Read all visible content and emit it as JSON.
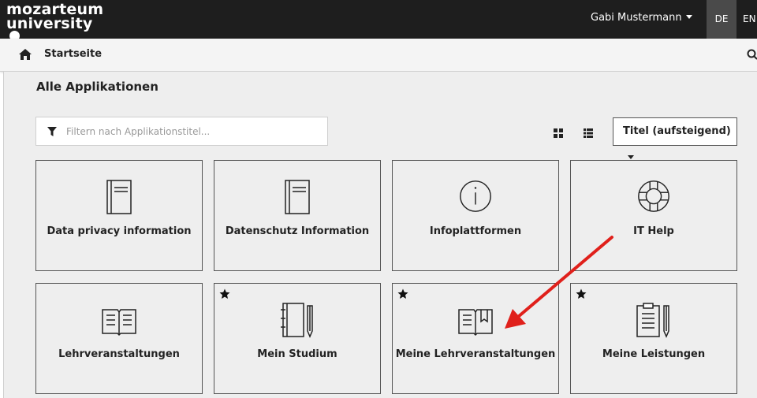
{
  "header": {
    "logo_line1": "mozarteum",
    "logo_line2": "university",
    "user_name": "Gabi Mustermann",
    "lang_de": "DE",
    "lang_en": "EN"
  },
  "nav": {
    "breadcrumb": "Startseite"
  },
  "main": {
    "title": "Alle Applikationen",
    "filter_placeholder": "Filtern nach Applikationstitel...",
    "sort_label": "Titel (aufsteigend)"
  },
  "tiles": [
    {
      "label": "Data privacy information",
      "icon": "document-icon",
      "favorite": false
    },
    {
      "label": "Datenschutz Information",
      "icon": "document-icon",
      "favorite": false
    },
    {
      "label": "Infoplattformen",
      "icon": "info-icon",
      "favorite": false
    },
    {
      "label": "IT Help",
      "icon": "lifebuoy-icon",
      "favorite": false
    },
    {
      "label": "Lehrveranstaltungen",
      "icon": "open-book-icon",
      "favorite": false
    },
    {
      "label": "Mein Studium",
      "icon": "notebook-pen-icon",
      "favorite": true
    },
    {
      "label": "Meine Lehrveranstaltungen",
      "icon": "book-bookmark-icon",
      "favorite": true
    },
    {
      "label": "Meine Leistungen",
      "icon": "clipboard-pen-icon",
      "favorite": true
    }
  ],
  "colors": {
    "header_bg": "#1e1e1e",
    "annotation_arrow": "#e0201b"
  }
}
